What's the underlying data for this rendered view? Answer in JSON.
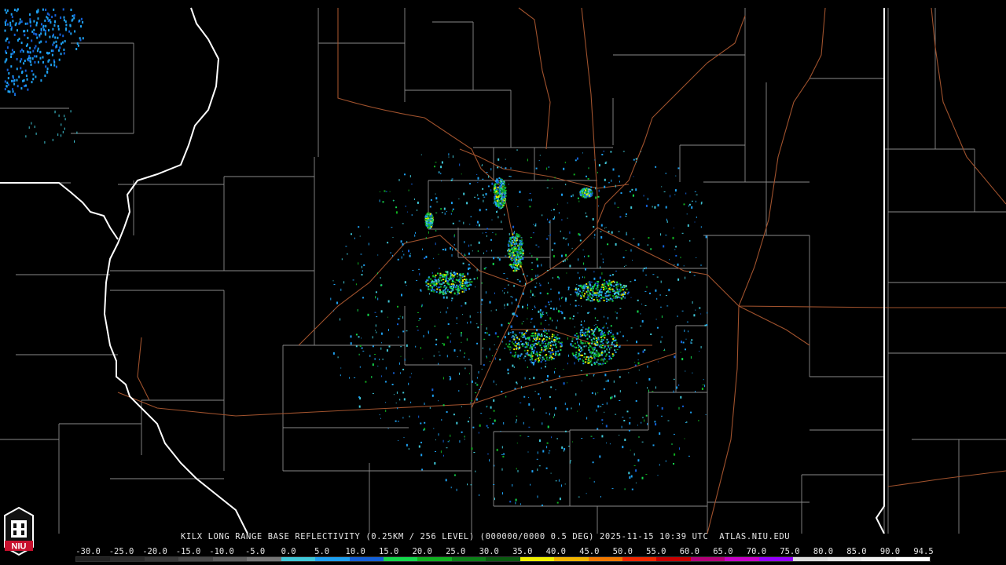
{
  "product": {
    "caption": "KILX LONG RANGE BASE REFLECTIVITY (0.25KM / 256 LEVEL) (000000/0000 0.5 DEG) 2025-11-15 10:39 UTC  ATLAS.NIU.EDU"
  },
  "logo": {
    "text": "NIU",
    "color": "#c8102e"
  },
  "colorbar": {
    "ticks": [
      "-30.0",
      "-25.0",
      "-20.0",
      "-15.0",
      "-10.0",
      "-5.0",
      "0.0",
      "5.0",
      "10.0",
      "15.0",
      "20.0",
      "25.0",
      "30.0",
      "35.0",
      "40.0",
      "45.0",
      "50.0",
      "55.0",
      "60.0",
      "65.0",
      "70.0",
      "75.0",
      "80.0",
      "85.0",
      "90.0",
      "94.5"
    ],
    "colors": [
      "#222222",
      "#2c2c2c",
      "#3a3a3a",
      "#4a4a4a",
      "#5e5e5e",
      "#767676",
      "#40c8d8",
      "#1ea0f0",
      "#1460d8",
      "#14d84c",
      "#10b020",
      "#0c8018",
      "#0a5a10",
      "#f0f000",
      "#f0b400",
      "#f07800",
      "#f02800",
      "#c80000",
      "#b40078",
      "#c800c8",
      "#9600ff",
      "#dcdcdc",
      "#e6e6e6",
      "#f0f0f0",
      "#ffffff"
    ]
  },
  "map_colors": {
    "background": "#000000",
    "county_lines": "#8a8a8a",
    "state_lines": "#ffffff",
    "highways": "#a0522d"
  }
}
